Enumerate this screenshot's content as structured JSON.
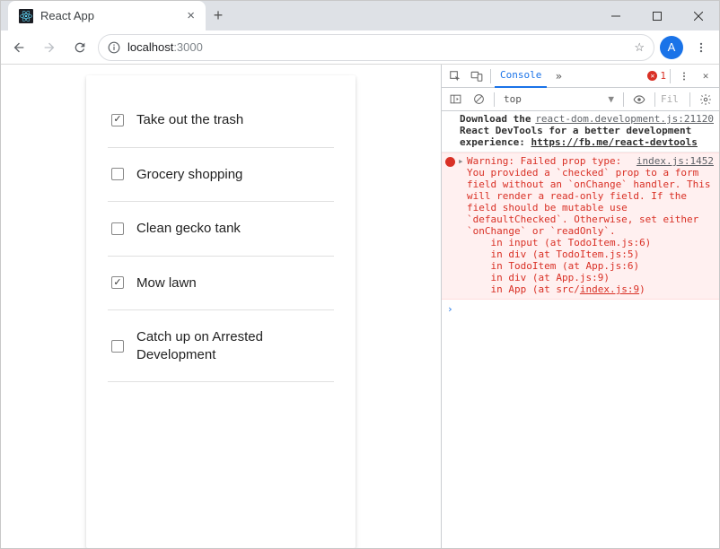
{
  "window": {
    "tab_title": "React App",
    "new_tab": "+"
  },
  "toolbar": {
    "url_host": "localhost",
    "url_port": ":3000",
    "avatar_letter": "A"
  },
  "todos": [
    {
      "label": "Take out the trash",
      "checked": true
    },
    {
      "label": "Grocery shopping",
      "checked": false
    },
    {
      "label": "Clean gecko tank",
      "checked": false
    },
    {
      "label": "Mow lawn",
      "checked": true
    },
    {
      "label": "Catch up on Arrested Development",
      "checked": false
    }
  ],
  "devtools": {
    "active_tab": "Console",
    "more": "»",
    "error_count": "1",
    "context": "top",
    "filter_placeholder": "Fil",
    "messages": {
      "info_src": "react-dom.development.js:21120",
      "info_text_a": "Download the React DevTools for a better development experience: ",
      "info_link": "https://fb.me/react-devtools",
      "err_src": "index.js:1452",
      "err_text": "Warning: Failed prop type: You provided a `checked` prop to a form field without an `onChange` handler. This will render a read-only field. If the field should be mutable use `defaultChecked`. Otherwise, set either `onChange` or `readOnly`.\n    in input (at TodoItem.js:6)\n    in div (at TodoItem.js:5)\n    in TodoItem (at App.js:6)\n    in div (at App.js:9)\n    in App (at src/",
      "err_tail_link": "index.js:9",
      "err_tail_close": ")"
    },
    "prompt": "›"
  }
}
